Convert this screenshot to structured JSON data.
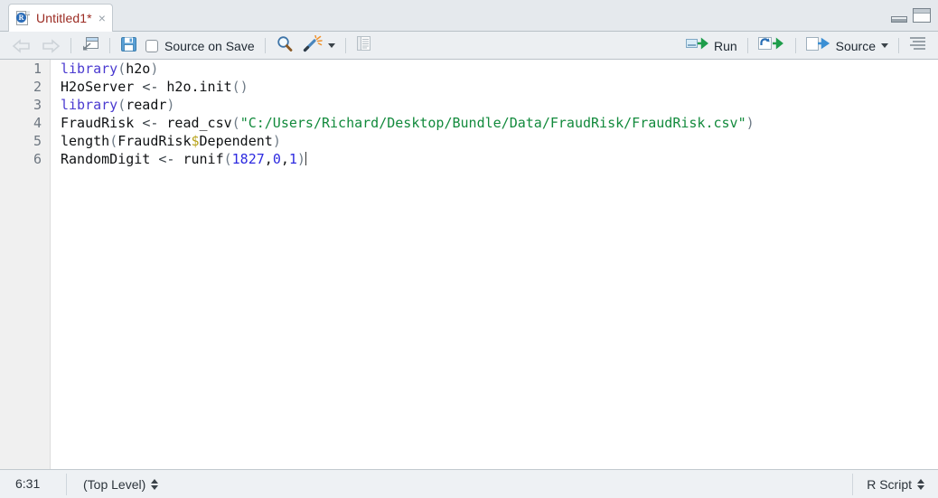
{
  "tab": {
    "title": "Untitled1*",
    "icon": "r-script-file-icon",
    "badge_letter": "R",
    "close_label": "×"
  },
  "pane_controls": {
    "minimize": "minimize-pane",
    "maximize": "maximize-pane"
  },
  "toolbar": {
    "back_label": "back",
    "forward_label": "forward",
    "popout_label": "show-in-new-window",
    "save_label": "save",
    "source_on_save_label": "Source on Save",
    "source_on_save_checked": false,
    "find_label": "find-replace",
    "code_tools_label": "code-tools",
    "compile_report_label": "compile-report",
    "run_label": "Run",
    "rerun_label": "re-run-previous",
    "source_label": "Source",
    "outline_label": "document-outline"
  },
  "editor": {
    "line_numbers": [
      "1",
      "2",
      "3",
      "4",
      "5",
      "6"
    ],
    "lines": [
      [
        {
          "t": "library",
          "c": "k"
        },
        {
          "t": "(",
          "c": "p"
        },
        {
          "t": "h2o",
          "c": ""
        },
        {
          "t": ")",
          "c": "p"
        }
      ],
      [
        {
          "t": "H2oServer ",
          "c": ""
        },
        {
          "t": "<-",
          "c": "op"
        },
        {
          "t": " h2o.init",
          "c": ""
        },
        {
          "t": "()",
          "c": "p"
        }
      ],
      [
        {
          "t": "library",
          "c": "k"
        },
        {
          "t": "(",
          "c": "p"
        },
        {
          "t": "readr",
          "c": ""
        },
        {
          "t": ")",
          "c": "p"
        }
      ],
      [
        {
          "t": "FraudRisk ",
          "c": ""
        },
        {
          "t": "<-",
          "c": "op"
        },
        {
          "t": " read_csv",
          "c": ""
        },
        {
          "t": "(",
          "c": "p"
        },
        {
          "t": "\"C:/Users/Richard/Desktop/Bundle/Data/FraudRisk/FraudRisk.csv\"",
          "c": "s"
        },
        {
          "t": ")",
          "c": "p"
        }
      ],
      [
        {
          "t": "length",
          "c": ""
        },
        {
          "t": "(",
          "c": "p"
        },
        {
          "t": "FraudRisk",
          "c": ""
        },
        {
          "t": "$",
          "c": "d"
        },
        {
          "t": "Dependent",
          "c": ""
        },
        {
          "t": ")",
          "c": "p"
        }
      ],
      [
        {
          "t": "RandomDigit ",
          "c": ""
        },
        {
          "t": "<-",
          "c": "op"
        },
        {
          "t": " runif",
          "c": ""
        },
        {
          "t": "(",
          "c": "p"
        },
        {
          "t": "1827",
          "c": "n"
        },
        {
          "t": ",",
          "c": ""
        },
        {
          "t": "0",
          "c": "n"
        },
        {
          "t": ",",
          "c": ""
        },
        {
          "t": "1",
          "c": "n"
        },
        {
          "t": ")",
          "c": "p"
        }
      ]
    ],
    "cursor_line_index": 5
  },
  "statusbar": {
    "cursor_position": "6:31",
    "scope": "(Top Level)",
    "doc_type": "R Script"
  },
  "colors": {
    "tab_title": "#9b2b22",
    "keyword": "#4a3ad0",
    "string": "#128a3c",
    "number": "#2d2ae0",
    "dollar": "#b8a31b",
    "run_arrow": "#1e9d4b",
    "source_arrow": "#3b8fd4",
    "save_blue": "#4a90c7"
  }
}
